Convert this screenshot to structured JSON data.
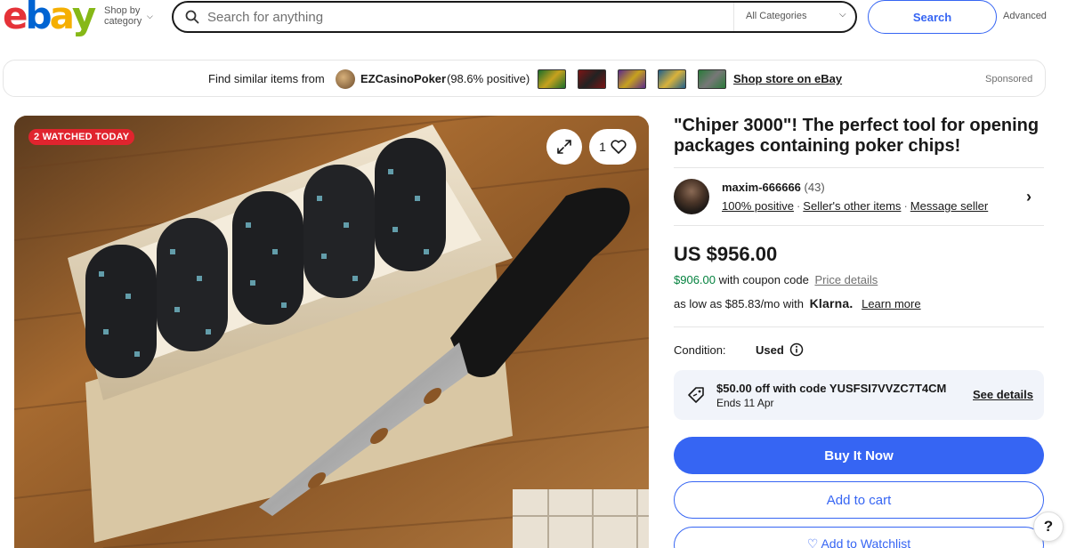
{
  "header": {
    "logo": {
      "e": "e",
      "b": "b",
      "a": "a",
      "y": "y",
      "colors": [
        "#e53238",
        "#0064d2",
        "#f5af02",
        "#86b817"
      ]
    },
    "shop_by_line1": "Shop by",
    "shop_by_line2": "category",
    "search_placeholder": "Search for anything",
    "category_select": "All Categories",
    "search_button": "Search",
    "advanced": "Advanced"
  },
  "store_banner": {
    "find_text": "Find similar items from",
    "store_name": "EZCasinoPoker",
    "store_rating": "(98.6% positive)",
    "shop_store": "Shop store on eBay",
    "sponsored": "Sponsored"
  },
  "gallery": {
    "watched_badge": "2 WATCHED TODAY",
    "watch_count": "1"
  },
  "item": {
    "title": "\"Chiper 3000\"! The perfect tool for opening packages containing poker chips!",
    "seller_name": "maxim-666666",
    "seller_count": "(43)",
    "seller_positive": "100% positive",
    "seller_other": "Seller's other items",
    "seller_message": "Message seller",
    "price": "US $956.00",
    "coupon_price": "$906.00",
    "coupon_with": "with coupon code",
    "price_details": "Price details",
    "klarna_prefix": "as low as $85.83/mo with",
    "klarna_brand": "Klarna.",
    "klarna_learn": "Learn more",
    "condition_label": "Condition:",
    "condition_value": "Used",
    "coupon_offer": "$50.00 off with code YUSFSI7VVZC7T4CM",
    "coupon_ends": "Ends 11 Apr",
    "see_details": "See details",
    "buy_now": "Buy It Now",
    "add_to_cart": "Add to cart",
    "add_to_watchlist": "Add to Watchlist",
    "help": "?"
  },
  "colors": {
    "accent_blue": "#3665f3",
    "badge_red": "#e0242e",
    "coupon_green": "#05823f",
    "coupon_bg": "#f1f4fa"
  }
}
